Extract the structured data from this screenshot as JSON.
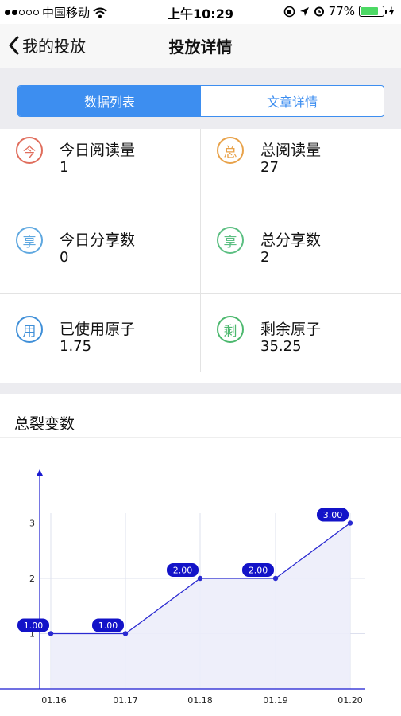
{
  "status_bar": {
    "carrier": "中国移动",
    "time": "上午10:29",
    "battery_percent": "77%",
    "battery_level": 0.77
  },
  "nav": {
    "back_label": "我的投放",
    "title": "投放详情"
  },
  "tabs": [
    {
      "label": "数据列表",
      "active": true
    },
    {
      "label": "文章详情",
      "active": false
    }
  ],
  "stats": [
    {
      "badge": "今",
      "label": "今日阅读量",
      "value": "1",
      "color": "#e06d5c"
    },
    {
      "badge": "总",
      "label": "总阅读量",
      "value": "27",
      "color": "#e8a24a"
    },
    {
      "badge": "享",
      "label": "今日分享数",
      "value": "0",
      "color": "#5fa8e0"
    },
    {
      "badge": "享",
      "label": "总分享数",
      "value": "2",
      "color": "#5cbf82"
    },
    {
      "badge": "用",
      "label": "已使用原子",
      "value": "1.75",
      "color": "#3f8fd8"
    },
    {
      "badge": "剩",
      "label": "剩余原子",
      "value": "35.25",
      "color": "#4cb86e"
    }
  ],
  "chart_section": {
    "title": "总裂变数"
  },
  "chart_data": {
    "type": "line",
    "categories": [
      "01.16",
      "01.17",
      "01.18",
      "01.19",
      "01.20"
    ],
    "values": [
      1.0,
      1.0,
      2.0,
      2.0,
      3.0
    ],
    "value_labels": [
      "1.00",
      "1.00",
      "2.00",
      "2.00",
      "3.00"
    ],
    "y_ticks": [
      "1",
      "2",
      "3"
    ],
    "ylim": [
      0,
      3.3
    ],
    "grid": true,
    "line_color": "#2a2ad1",
    "fill_color": "#ecedfa",
    "label_color": "#1313c8"
  }
}
